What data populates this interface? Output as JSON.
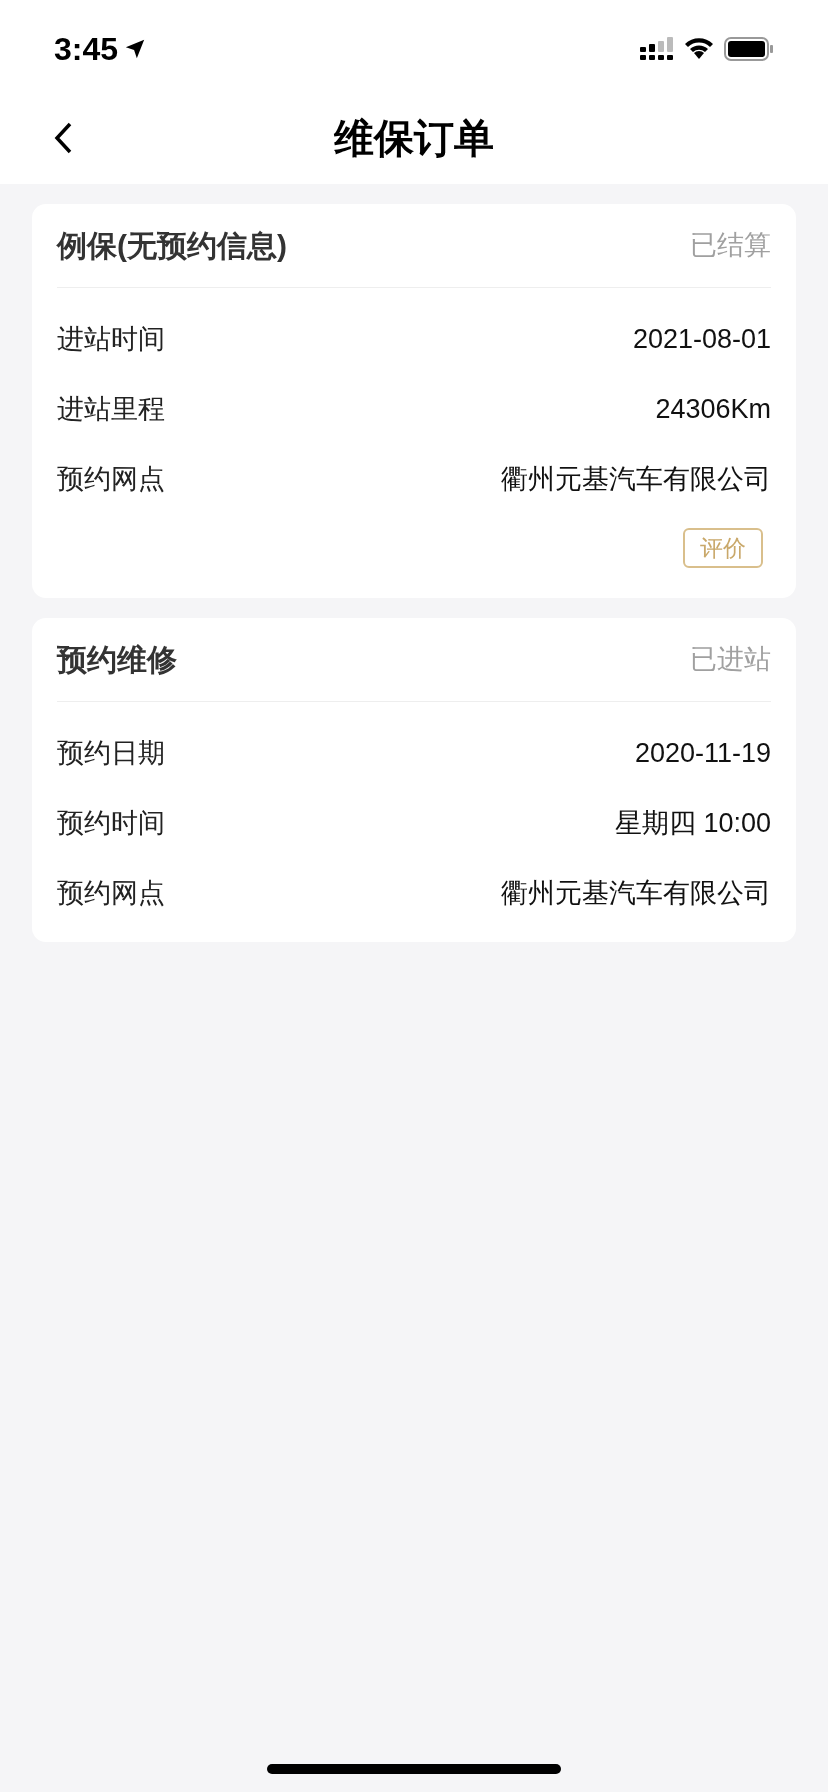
{
  "status_bar": {
    "time": "3:45"
  },
  "nav": {
    "title": "维保订单"
  },
  "orders": [
    {
      "title": "例保(无预约信息)",
      "status": "已结算",
      "rows": [
        {
          "label": "进站时间",
          "value": "2021-08-01"
        },
        {
          "label": "进站里程",
          "value": "24306Km"
        },
        {
          "label": "预约网点",
          "value": "衢州元基汽车有限公司"
        }
      ],
      "action": "评价"
    },
    {
      "title": "预约维修",
      "status": "已进站",
      "rows": [
        {
          "label": "预约日期",
          "value": "2020-11-19"
        },
        {
          "label": "预约时间",
          "value": "星期四 10:00"
        },
        {
          "label": "预约网点",
          "value": "衢州元基汽车有限公司"
        }
      ]
    }
  ]
}
